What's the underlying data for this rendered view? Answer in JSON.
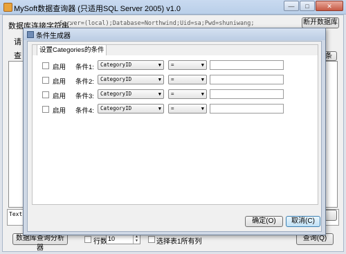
{
  "main": {
    "title": "MySoft数据查询器 (只适用SQL Server 2005) v1.0",
    "conn_label": "数据库连接字符串:",
    "conn_value": "Server=(local);Database=Northwind;Uid=sa;Pwd=shuniwang;",
    "disconnect_button": "断开数据库",
    "side_label_1": "请",
    "side_label_2": "查",
    "right_stub_1": "条",
    "right_stub_2": "",
    "text_strip": "Text",
    "analyzer_button": "数据库查询分析器",
    "rows_label": "行数",
    "rows_value": "10",
    "select_all_label": "选择表1所有列",
    "query_button": "查询(Q)"
  },
  "dialog": {
    "title": "条件生成器",
    "tab_label": "设置Categories的条件",
    "enable_label": "启用",
    "rows": [
      {
        "cond_label": "条件1:",
        "field": "CategoryID",
        "op": "=",
        "value": ""
      },
      {
        "cond_label": "条件2:",
        "field": "CategoryID",
        "op": "=",
        "value": ""
      },
      {
        "cond_label": "条件3:",
        "field": "CategoryID",
        "op": "=",
        "value": ""
      },
      {
        "cond_label": "条件4:",
        "field": "CategoryID",
        "op": "=",
        "value": ""
      }
    ],
    "ok_button": "确定(O)",
    "cancel_button": "取消(C)"
  },
  "colors": {
    "title_bar": "#c9daf0",
    "dialog_border": "#6e7f96",
    "focus_button": "#3c7fb1"
  }
}
